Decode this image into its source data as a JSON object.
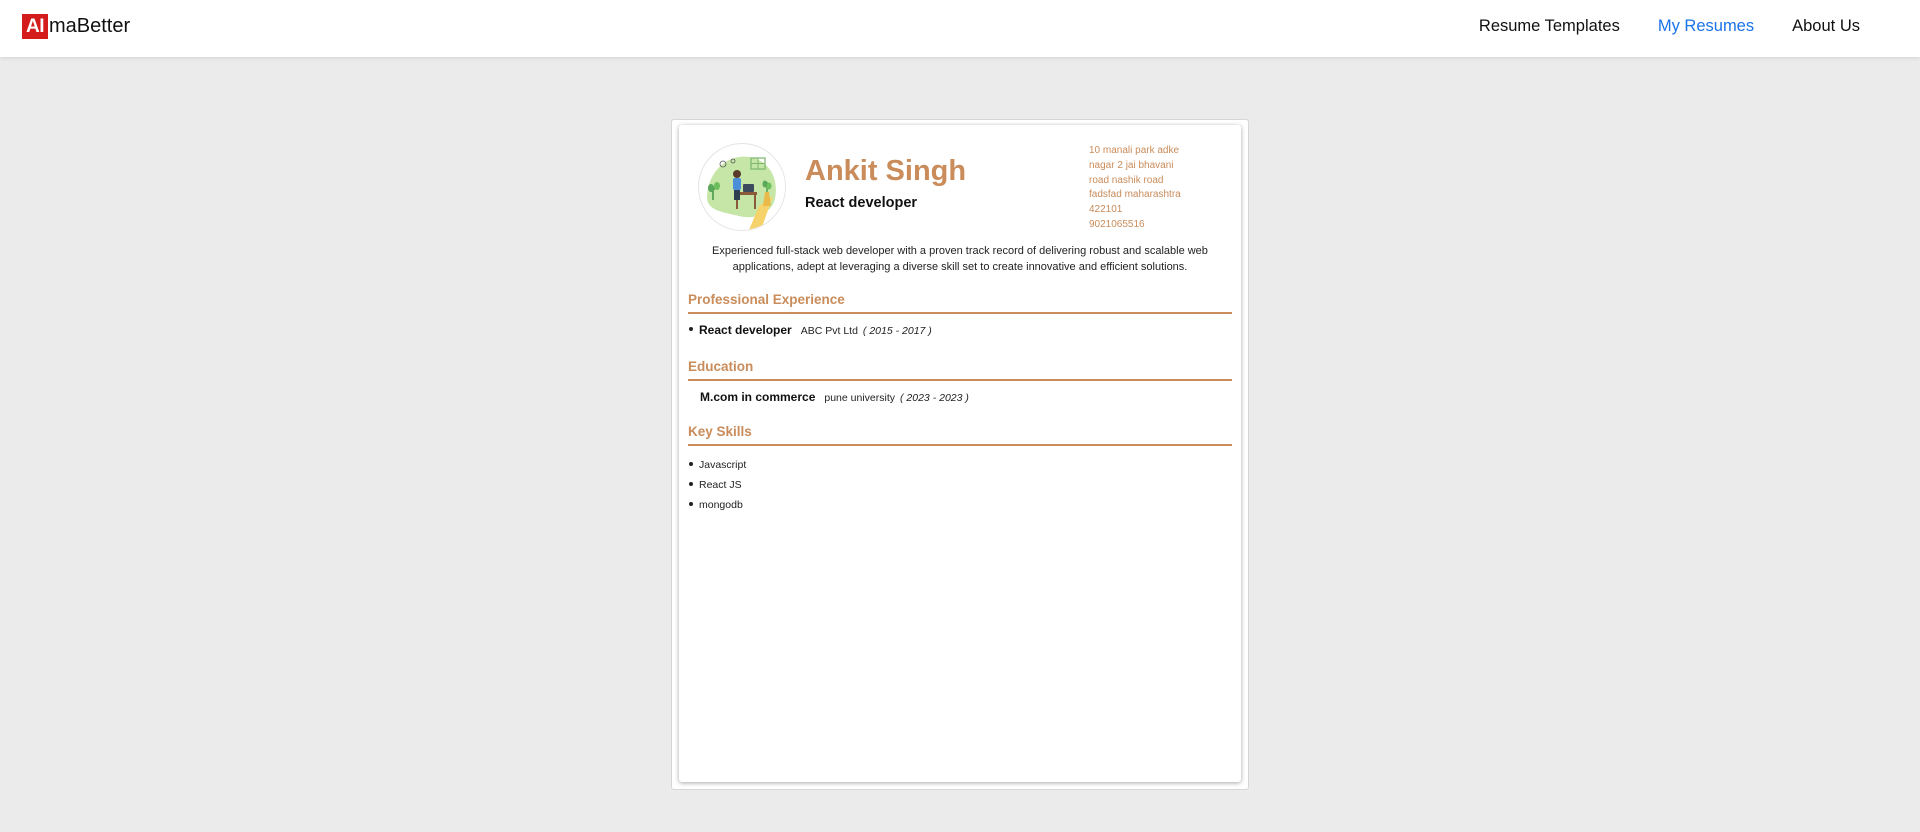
{
  "header": {
    "logo_mark": "AI",
    "logo_text": "maBetter",
    "nav": [
      {
        "label": "Resume Templates"
      },
      {
        "label": "My Resumes"
      },
      {
        "label": "About Us"
      }
    ],
    "active_nav_color": "#1a73e8"
  },
  "resume": {
    "name": "Ankit Singh",
    "title": "React developer",
    "address": "10 manali park adke\nnagar 2 jai bhavani\nroad nashik road\nfadsfad  maharashtra\n 422101\n9021065516",
    "summary": "Experienced full-stack web developer with a proven track record of delivering robust and scalable web applications, adept at leveraging a diverse skill set to create innovative and efficient solutions.",
    "accent_color": "#c98c5a",
    "experience_heading": "Professional Experience",
    "experience": [
      {
        "role": "React developer",
        "company": "ABC Pvt Ltd",
        "dates": "( 2015 - 2017 )"
      }
    ],
    "education_heading": "Education",
    "education": [
      {
        "degree": "M.com in commerce",
        "institute": "pune university",
        "dates": "( 2023 - 2023 )"
      }
    ],
    "skills_heading": "Key Skills",
    "skills": [
      "Javascript",
      "React JS",
      "mongodb"
    ]
  }
}
